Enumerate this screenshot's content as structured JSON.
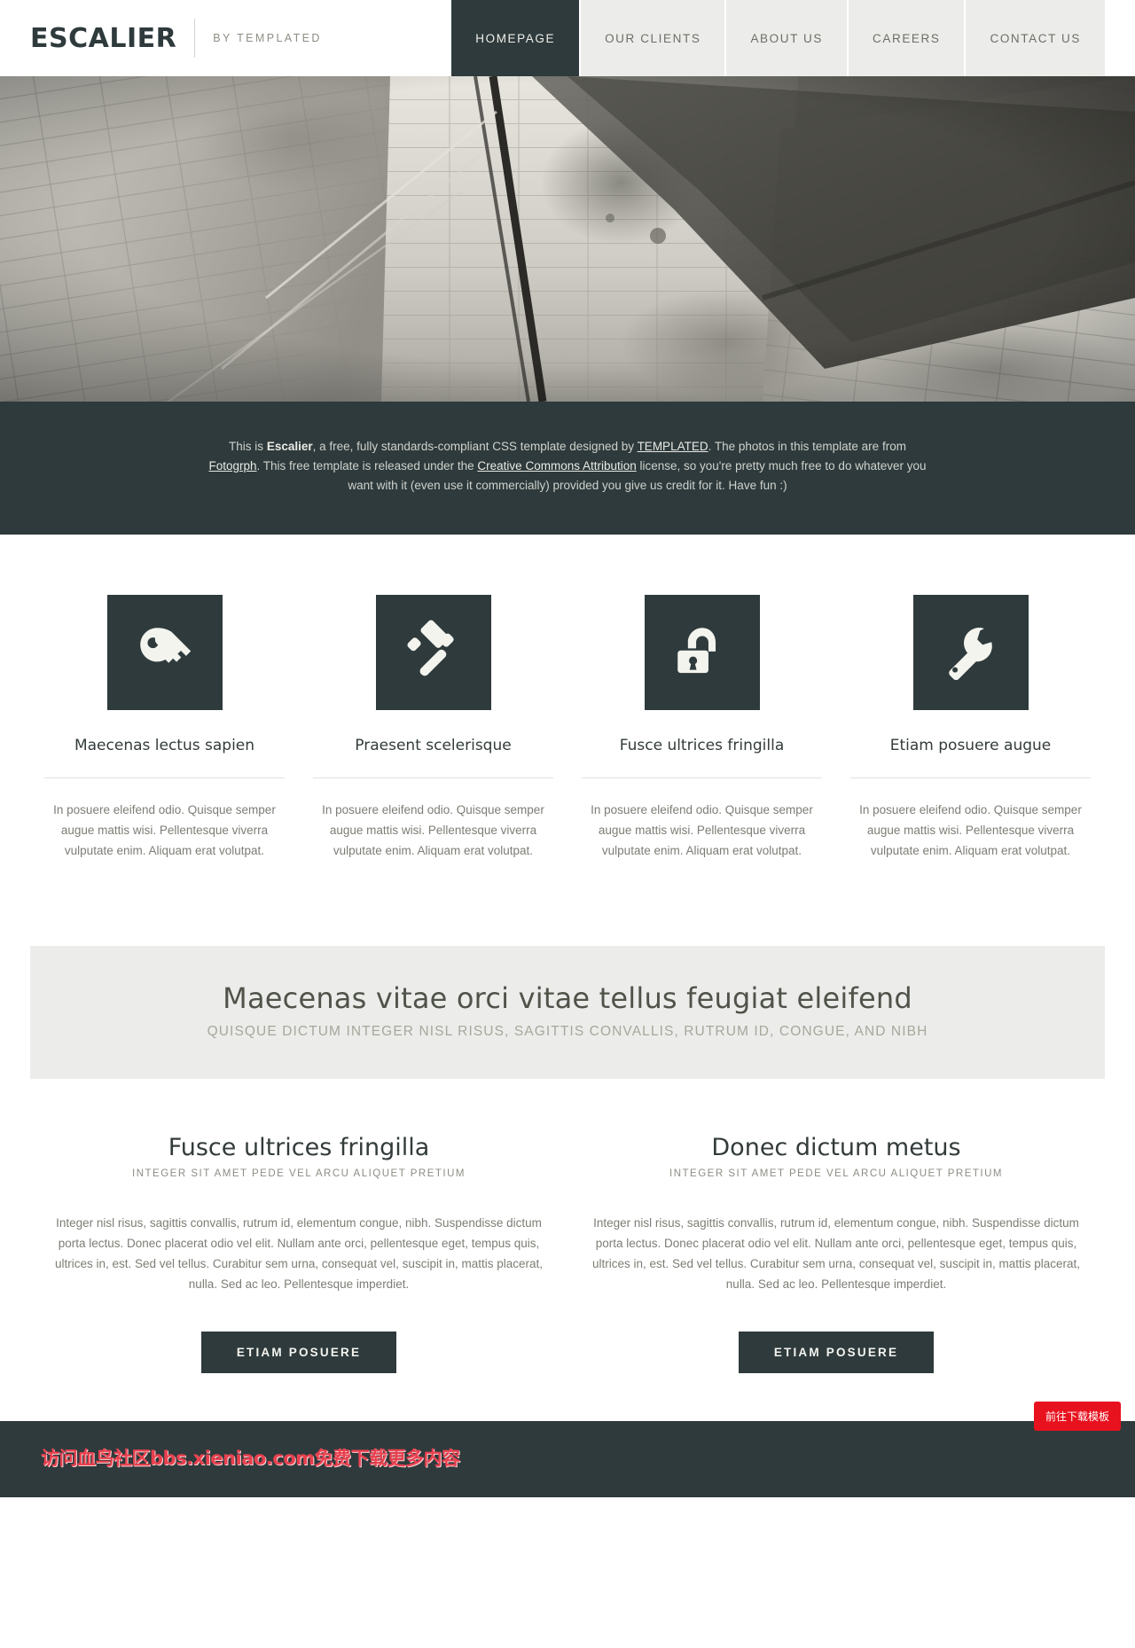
{
  "colors": {
    "dark": "#2e3a3c",
    "nav_inactive_bg": "#ececea",
    "body_text": "#7d7d76",
    "accent_red": "#e8111e",
    "watermark_red": "#e8414f"
  },
  "header": {
    "logo": "ESCALIER",
    "logo_sub": "BY TEMPLATED",
    "nav": [
      {
        "label": "HOMEPAGE",
        "active": true
      },
      {
        "label": "OUR CLIENTS",
        "active": false
      },
      {
        "label": "ABOUT US",
        "active": false
      },
      {
        "label": "CAREERS",
        "active": false
      },
      {
        "label": "CONTACT US",
        "active": false
      }
    ]
  },
  "banner": {
    "alt": "black and white photo of a concrete stairwell with metal railing"
  },
  "intro": {
    "part1": "This is ",
    "brand": "Escalier",
    "part2": ", a free, fully standards-compliant CSS template designed by ",
    "link1": "TEMPLATED",
    "part3": ". The photos in this template are from ",
    "link2": "Fotogrph",
    "part4": ". This free template is released under the ",
    "link3": "Creative Commons Attribution",
    "part5": " license, so you're pretty much free to do whatever you want with it (even use it commercially) provided you give us credit for it. Have fun :)"
  },
  "features": [
    {
      "icon": "key-icon",
      "title": "Maecenas lectus sapien",
      "text": "In posuere eleifend odio. Quisque semper augue mattis wisi. Pellentesque viverra vulputate enim. Aliquam erat volutpat."
    },
    {
      "icon": "gavel-icon",
      "title": "Praesent scelerisque",
      "text": "In posuere eleifend odio. Quisque semper augue mattis wisi. Pellentesque viverra vulputate enim. Aliquam erat volutpat."
    },
    {
      "icon": "unlock-icon",
      "title": "Fusce ultrices fringilla",
      "text": "In posuere eleifend odio. Quisque semper augue mattis wisi. Pellentesque viverra vulputate enim. Aliquam erat volutpat."
    },
    {
      "icon": "wrench-icon",
      "title": "Etiam posuere augue",
      "text": "In posuere eleifend odio. Quisque semper augue mattis wisi. Pellentesque viverra vulputate enim. Aliquam erat volutpat."
    }
  ],
  "highlight": {
    "title": "Maecenas vitae orci vitae tellus feugiat eleifend",
    "subtitle": "QUISQUE DICTUM INTEGER NISL RISUS, SAGITTIS CONVALLIS, RUTRUM ID, CONGUE, AND NIBH"
  },
  "columns": [
    {
      "title": "Fusce ultrices fringilla",
      "subtitle": "INTEGER SIT AMET PEDE VEL ARCU ALIQUET PRETIUM",
      "body": "Integer nisl risus, sagittis convallis, rutrum id, elementum congue, nibh. Suspendisse dictum porta lectus. Donec placerat odio vel elit. Nullam ante orci, pellentesque eget, tempus quis, ultrices in, est. Sed vel tellus. Curabitur sem urna, consequat vel, suscipit in, mattis placerat, nulla. Sed ac leo. Pellentesque imperdiet.",
      "button": "ETIAM POSUERE"
    },
    {
      "title": "Donec dictum metus",
      "subtitle": "INTEGER SIT AMET PEDE VEL ARCU ALIQUET PRETIUM",
      "body": "Integer nisl risus, sagittis convallis, rutrum id, elementum congue, nibh. Suspendisse dictum porta lectus. Donec placerat odio vel elit. Nullam ante orci, pellentesque eget, tempus quis, ultrices in, est. Sed vel tellus. Curabitur sem urna, consequat vel, suscipit in, mattis placerat, nulla. Sed ac leo. Pellentesque imperdiet.",
      "button": "ETIAM POSUERE"
    }
  ],
  "footer": {
    "watermark": "访问血鸟社区bbs.xieniao.com免费下载更多内容",
    "download_button": "前往下载模板"
  }
}
